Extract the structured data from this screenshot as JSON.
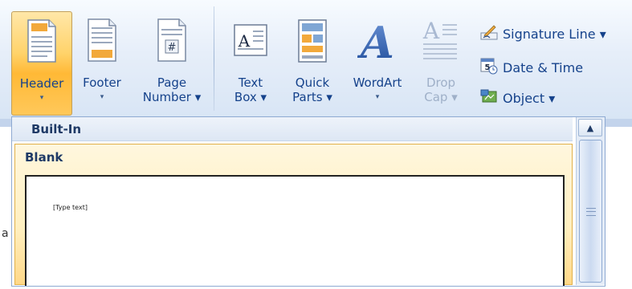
{
  "ribbon": {
    "buttons": {
      "header": {
        "label": "Header",
        "arrow": "▾"
      },
      "footer": {
        "label": "Footer",
        "arrow": "▾"
      },
      "page_number": {
        "label1": "Page",
        "label2": "Number ▾"
      },
      "text_box": {
        "label1": "Text",
        "label2": "Box ▾"
      },
      "quick_parts": {
        "label1": "Quick",
        "label2": "Parts ▾"
      },
      "wordart": {
        "label": "WordArt",
        "arrow": "▾"
      },
      "drop_cap": {
        "label1": "Drop",
        "label2": "Cap ▾"
      }
    },
    "small_buttons": {
      "signature_line": "Signature Line ▾",
      "date_time": "Date & Time",
      "object": "Object ▾"
    },
    "icons": {
      "text_box_glyph": "A",
      "wordart_glyph": "A",
      "drop_cap_glyph": "A",
      "page_number_glyph": "#",
      "date_glyph": "5"
    }
  },
  "gallery": {
    "heading": "Built-In",
    "items": [
      {
        "title": "Blank",
        "preview_text": "[Type text]"
      }
    ],
    "scroll_up": "▲"
  },
  "document": {
    "fragment": "a"
  },
  "colors": {
    "accent_orange": "#ffb936",
    "ribbon_text": "#15428b"
  }
}
